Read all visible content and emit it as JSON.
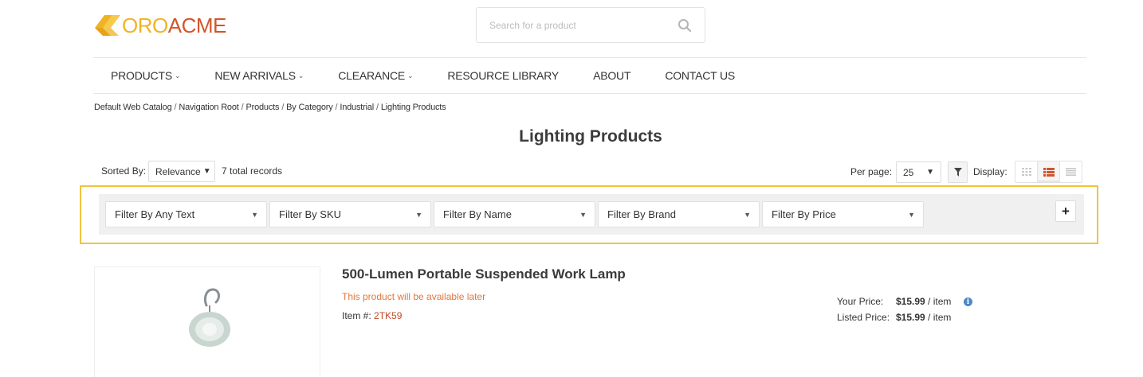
{
  "brand": {
    "logo_part1": "ORO",
    "logo_part2": "ACME",
    "colors": {
      "oro": "#f0b323",
      "acme": "#d3542a"
    }
  },
  "search": {
    "placeholder": "Search for a product",
    "icon": "search-icon"
  },
  "nav": {
    "items": [
      {
        "label": "PRODUCTS",
        "has_dropdown": true
      },
      {
        "label": "NEW ARRIVALS",
        "has_dropdown": true
      },
      {
        "label": "CLEARANCE",
        "has_dropdown": true
      },
      {
        "label": "RESOURCE LIBRARY",
        "has_dropdown": false
      },
      {
        "label": "ABOUT",
        "has_dropdown": false
      },
      {
        "label": "CONTACT US",
        "has_dropdown": false
      }
    ],
    "chevron": "⌵"
  },
  "breadcrumb": [
    "Default Web Catalog",
    "Navigation Root",
    "Products",
    "By Category",
    "Industrial",
    "Lighting Products"
  ],
  "page_title": "Lighting Products",
  "toolbar": {
    "sorted_by_label": "Sorted By:",
    "sort_value": "Relevance",
    "total_records": "7 total records",
    "per_page_label": "Per page:",
    "per_page_value": "25",
    "display_label": "Display:",
    "active_view": "list"
  },
  "filters": {
    "items": [
      "Filter By Any Text",
      "Filter By SKU",
      "Filter By Name",
      "Filter By Brand",
      "Filter By Price"
    ],
    "add_label": "+"
  },
  "product": {
    "name": "500-Lumen Portable Suspended Work Lamp",
    "availability": "This product will be available later",
    "item_label": "Item #:",
    "sku": "2TK59",
    "your_price_label": "Your Price:",
    "your_price": "$15.99",
    "listed_price_label": "Listed Price:",
    "listed_price": "$15.99",
    "unit": "/ item",
    "info_icon": "info-icon"
  }
}
